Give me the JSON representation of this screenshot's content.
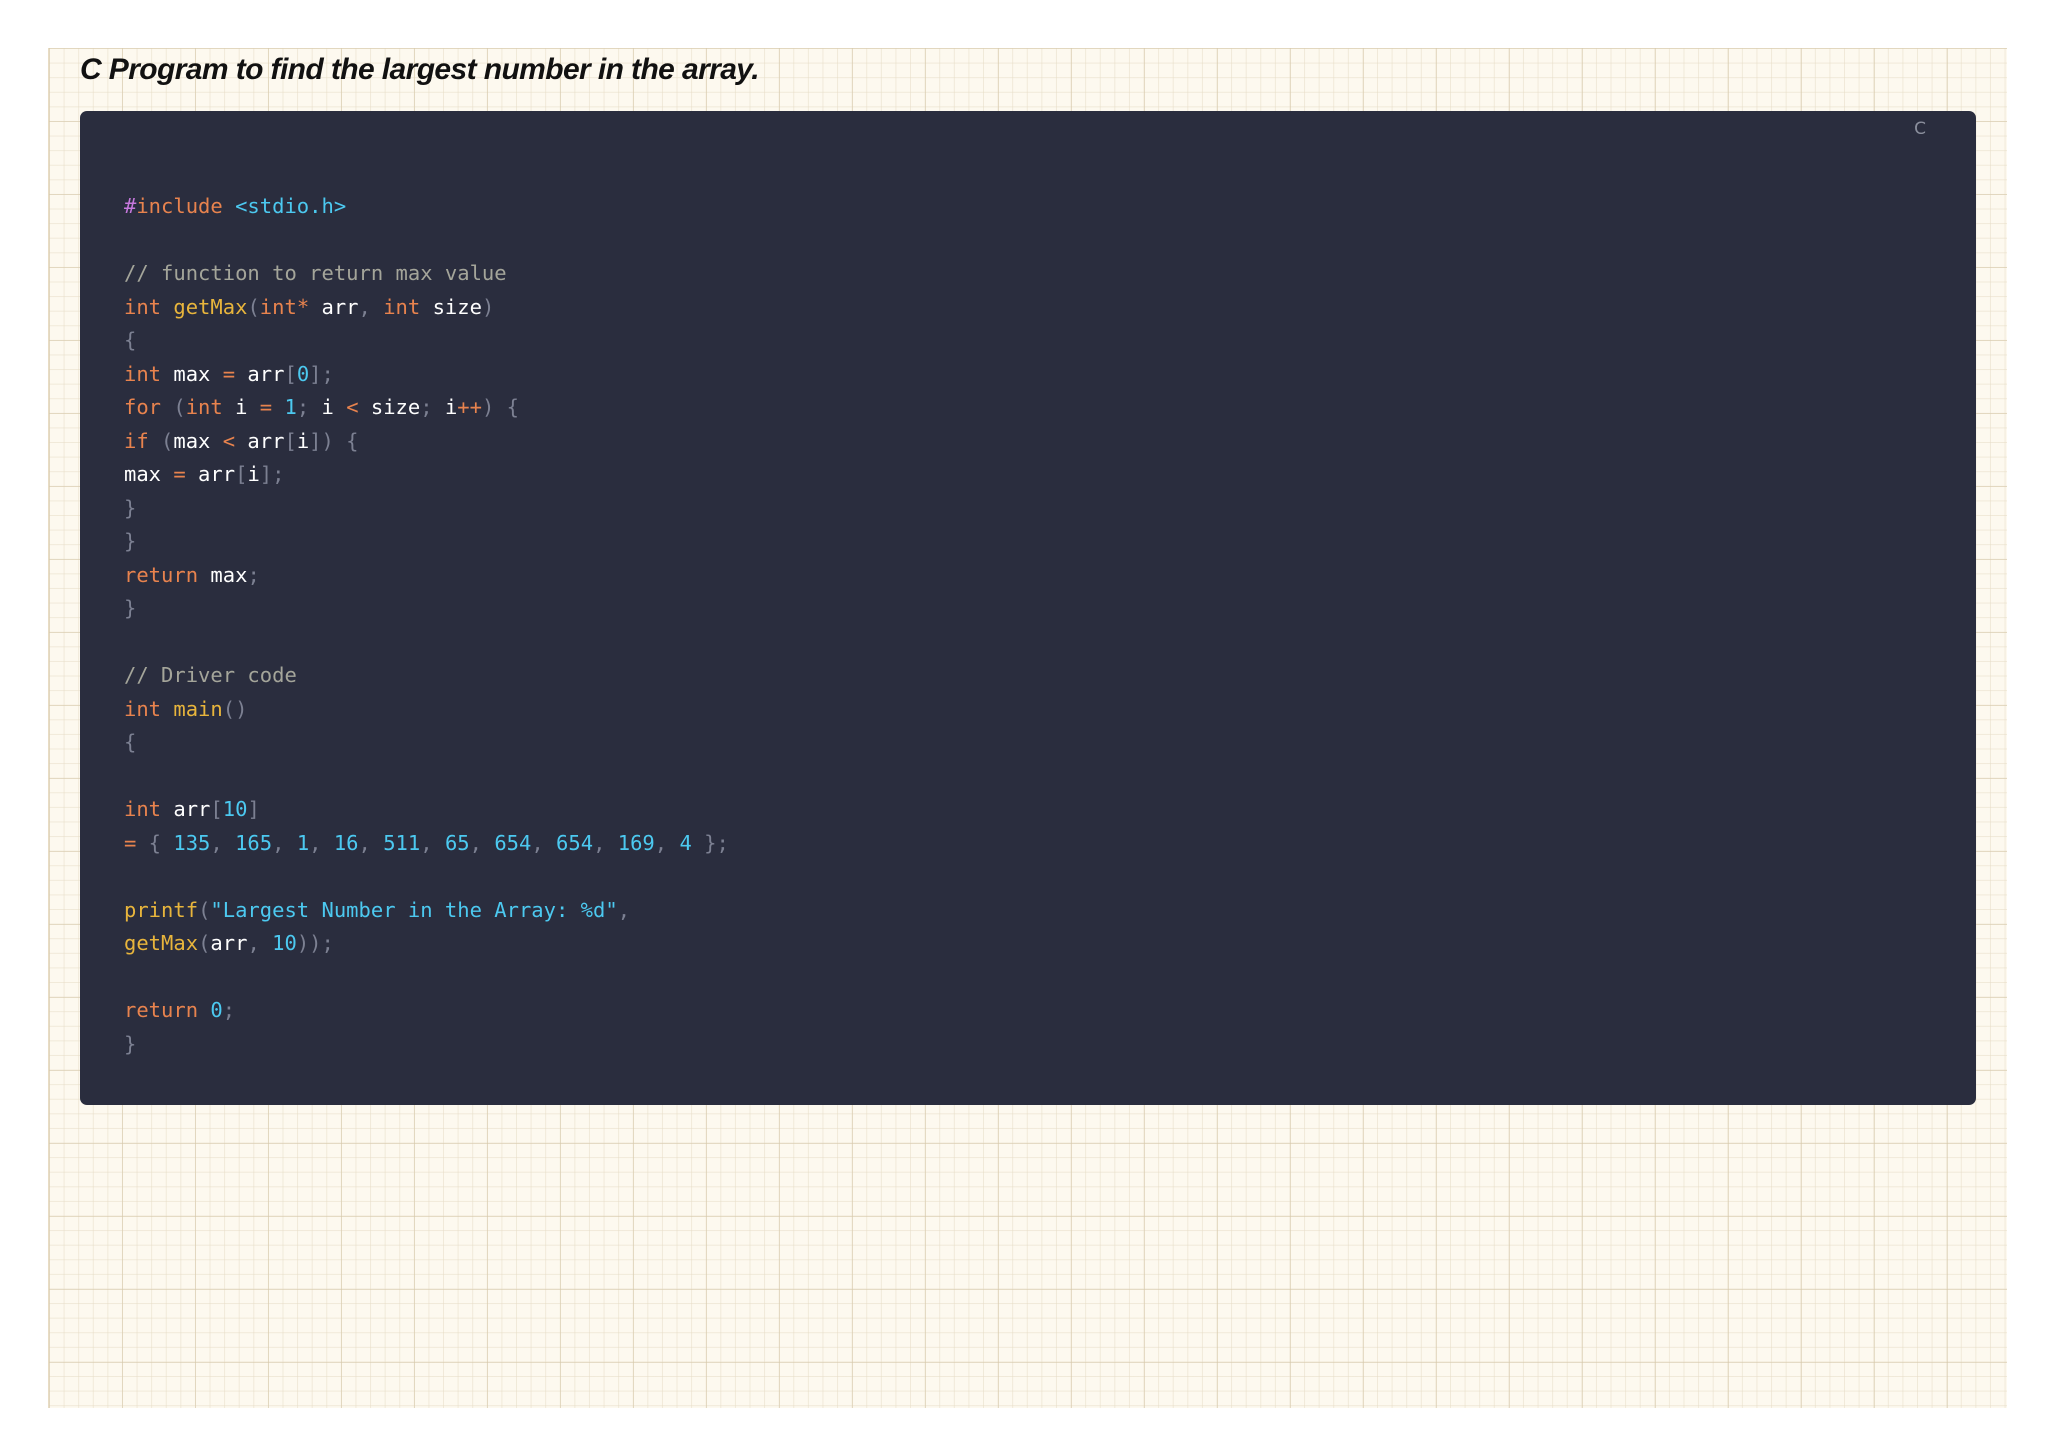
{
  "page": {
    "heading": "C Program to find the largest number in the array."
  },
  "code_block": {
    "language_label": "C",
    "lines": [
      [
        [
          "pre-hash",
          "#"
        ],
        [
          "kw",
          "include "
        ],
        [
          "str",
          "<stdio.h>"
        ]
      ],
      [],
      [
        [
          "com",
          "// function to return max value"
        ]
      ],
      [
        [
          "kw",
          "int "
        ],
        [
          "fn",
          "getMax"
        ],
        [
          "p",
          "("
        ],
        [
          "kw",
          "int"
        ],
        [
          "op",
          "*"
        ],
        [
          "id",
          " arr"
        ],
        [
          "p",
          ", "
        ],
        [
          "kw",
          "int "
        ],
        [
          "id",
          "size"
        ],
        [
          "p",
          ")"
        ]
      ],
      [
        [
          "p",
          "{"
        ]
      ],
      [
        [
          "kw",
          "int "
        ],
        [
          "id",
          "max "
        ],
        [
          "op",
          "="
        ],
        [
          "id",
          " arr"
        ],
        [
          "p",
          "["
        ],
        [
          "num",
          "0"
        ],
        [
          "p",
          "];"
        ]
      ],
      [
        [
          "kw",
          "for "
        ],
        [
          "p",
          "("
        ],
        [
          "kw",
          "int "
        ],
        [
          "id",
          "i "
        ],
        [
          "op",
          "="
        ],
        [
          "sp",
          " "
        ],
        [
          "num",
          "1"
        ],
        [
          "p",
          "; "
        ],
        [
          "id",
          "i "
        ],
        [
          "op",
          "<"
        ],
        [
          "id",
          " size"
        ],
        [
          "p",
          "; "
        ],
        [
          "id",
          "i"
        ],
        [
          "op",
          "++"
        ],
        [
          "p",
          ") {"
        ]
      ],
      [
        [
          "kw",
          "if "
        ],
        [
          "p",
          "("
        ],
        [
          "id",
          "max "
        ],
        [
          "op",
          "<"
        ],
        [
          "id",
          " arr"
        ],
        [
          "p",
          "["
        ],
        [
          "id",
          "i"
        ],
        [
          "p",
          "]) {"
        ]
      ],
      [
        [
          "id",
          "max "
        ],
        [
          "op",
          "="
        ],
        [
          "id",
          " arr"
        ],
        [
          "p",
          "["
        ],
        [
          "id",
          "i"
        ],
        [
          "p",
          "];"
        ]
      ],
      [
        [
          "p",
          "}"
        ]
      ],
      [
        [
          "p",
          "}"
        ]
      ],
      [
        [
          "kw",
          "return "
        ],
        [
          "id",
          "max"
        ],
        [
          "p",
          ";"
        ]
      ],
      [
        [
          "p",
          "}"
        ]
      ],
      [],
      [
        [
          "com",
          "// Driver code"
        ]
      ],
      [
        [
          "kw",
          "int "
        ],
        [
          "fn",
          "main"
        ],
        [
          "p",
          "()"
        ]
      ],
      [
        [
          "p",
          "{"
        ]
      ],
      [],
      [
        [
          "kw",
          "int "
        ],
        [
          "id",
          "arr"
        ],
        [
          "p",
          "["
        ],
        [
          "num",
          "10"
        ],
        [
          "p",
          "]"
        ]
      ],
      [
        [
          "op",
          "="
        ],
        [
          "p",
          " { "
        ],
        [
          "num",
          "135"
        ],
        [
          "p",
          ", "
        ],
        [
          "num",
          "165"
        ],
        [
          "p",
          ", "
        ],
        [
          "num",
          "1"
        ],
        [
          "p",
          ", "
        ],
        [
          "num",
          "16"
        ],
        [
          "p",
          ", "
        ],
        [
          "num",
          "511"
        ],
        [
          "p",
          ", "
        ],
        [
          "num",
          "65"
        ],
        [
          "p",
          ", "
        ],
        [
          "num",
          "654"
        ],
        [
          "p",
          ", "
        ],
        [
          "num",
          "654"
        ],
        [
          "p",
          ", "
        ],
        [
          "num",
          "169"
        ],
        [
          "p",
          ", "
        ],
        [
          "num",
          "4"
        ],
        [
          "p",
          " };"
        ]
      ],
      [],
      [
        [
          "fn",
          "printf"
        ],
        [
          "p",
          "("
        ],
        [
          "str",
          "\"Largest Number in the Array: %d\""
        ],
        [
          "p",
          ","
        ]
      ],
      [
        [
          "fn",
          "getMax"
        ],
        [
          "p",
          "("
        ],
        [
          "id",
          "arr"
        ],
        [
          "p",
          ", "
        ],
        [
          "num",
          "10"
        ],
        [
          "p",
          "));"
        ]
      ],
      [],
      [
        [
          "kw",
          "return "
        ],
        [
          "num",
          "0"
        ],
        [
          "p",
          ";"
        ]
      ],
      [
        [
          "p",
          "}"
        ]
      ]
    ]
  },
  "colors": {
    "code_background": "#2a2d3e",
    "keyword": "#e8834e",
    "function_name": "#e8b53c",
    "string_and_number": "#4cc9f0",
    "comment": "#a4a59a",
    "punctuation": "#7c8092",
    "preprocessor_hash": "#c678dd",
    "identifier": "#ffffff",
    "paper": "#fdf9ef"
  }
}
